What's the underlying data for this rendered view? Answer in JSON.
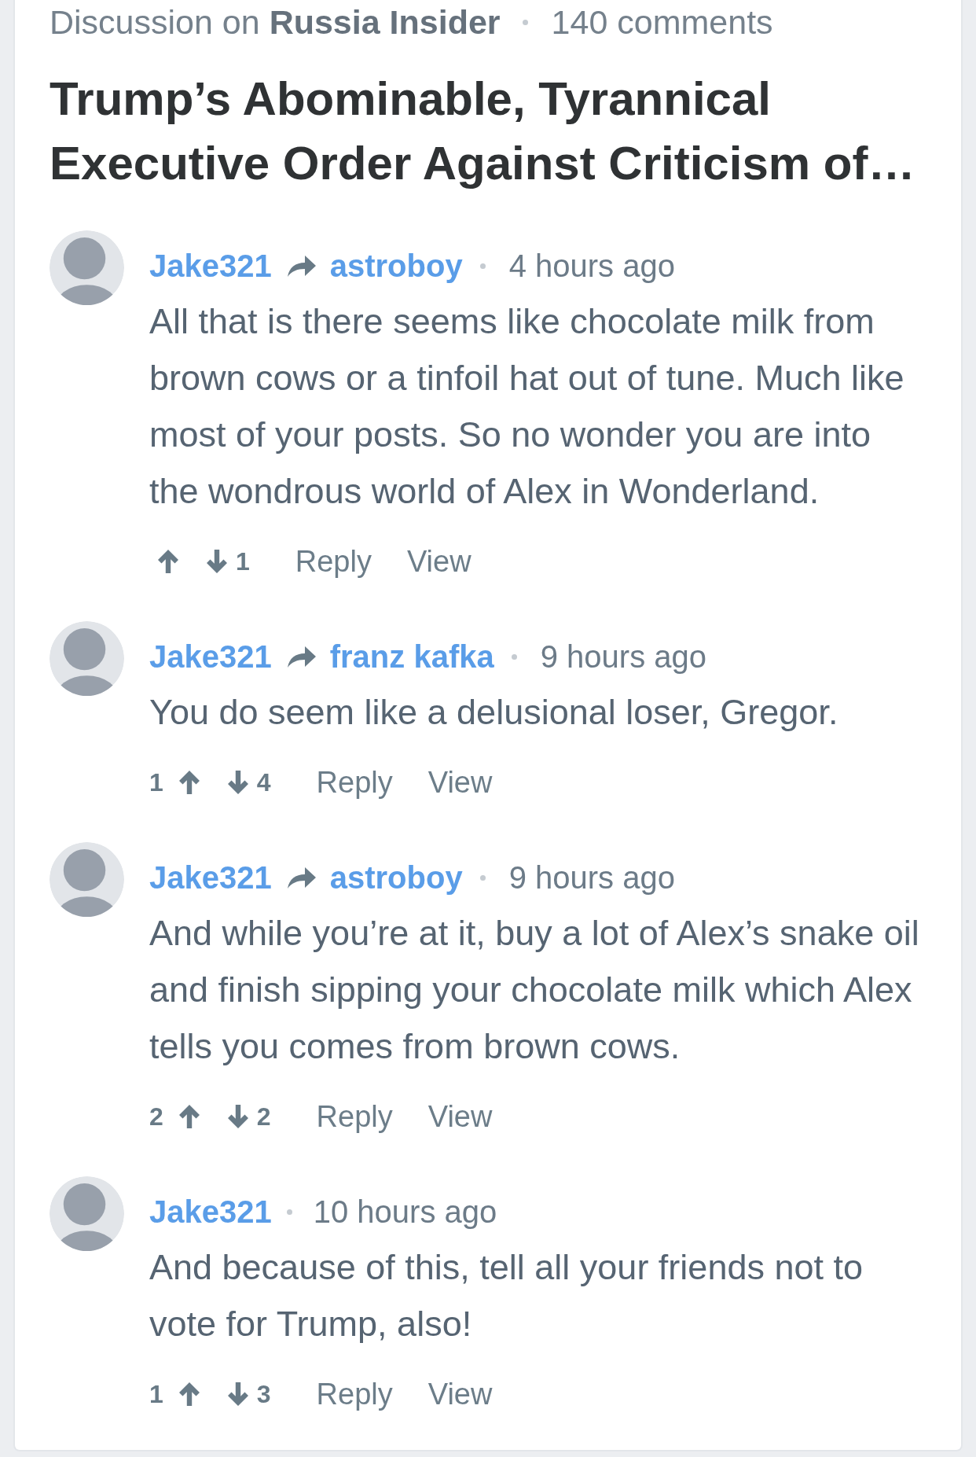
{
  "header": {
    "source": "Discussion on **Russia Insider**",
    "comment_count": "140 comments"
  },
  "title_lines": [
    "Trump’s Abominable, Tyrannical",
    "Executive Order Against Criticism of…"
  ],
  "comments": [
    {
      "author": "Jake321",
      "reply_to": "astroboy",
      "time": "4 hours ago",
      "body_lines": [
        "All that is there seems like chocolate milk from",
        "brown cows or a tinfoil hat out of tune. Much like",
        "most of your posts. So no wonder you are into",
        "the wondrous world of Alex in Wonderland."
      ],
      "votes": {
        "downvotes": "1"
      },
      "actions": [
        {
          "kind": "reply",
          "label": "Reply"
        },
        {
          "kind": "view",
          "label": "View"
        }
      ]
    },
    {
      "author": "Jake321",
      "reply_to": "franz kafka",
      "time": "9 hours ago",
      "body_lines": [
        "You do seem like a delusional loser, Gregor."
      ],
      "votes": {
        "upvotes": "1",
        "downvotes": "4"
      },
      "actions": [
        {
          "kind": "reply",
          "label": "Reply"
        },
        {
          "kind": "view",
          "label": "View"
        }
      ]
    },
    {
      "author": "Jake321",
      "reply_to": "astroboy",
      "time": "9 hours ago",
      "body_lines": [
        "And while you’re at it, buy a lot of Alex’s snake oil",
        "and finish sipping your chocolate milk which Alex",
        "tells you comes from brown cows."
      ],
      "votes": {
        "upvotes": "2",
        "downvotes": "2"
      },
      "actions": [
        {
          "kind": "reply",
          "label": "Reply"
        },
        {
          "kind": "view",
          "label": "View"
        }
      ]
    },
    {
      "author": "Jake321",
      "time": "10 hours ago",
      "body_lines": [
        "And because of this, tell all your friends not to",
        "vote for Trump, also!"
      ],
      "votes": {
        "upvotes": "1",
        "downvotes": "3"
      },
      "actions": [
        {
          "kind": "reply",
          "label": "Reply"
        },
        {
          "kind": "view",
          "label": "View"
        }
      ]
    }
  ]
}
